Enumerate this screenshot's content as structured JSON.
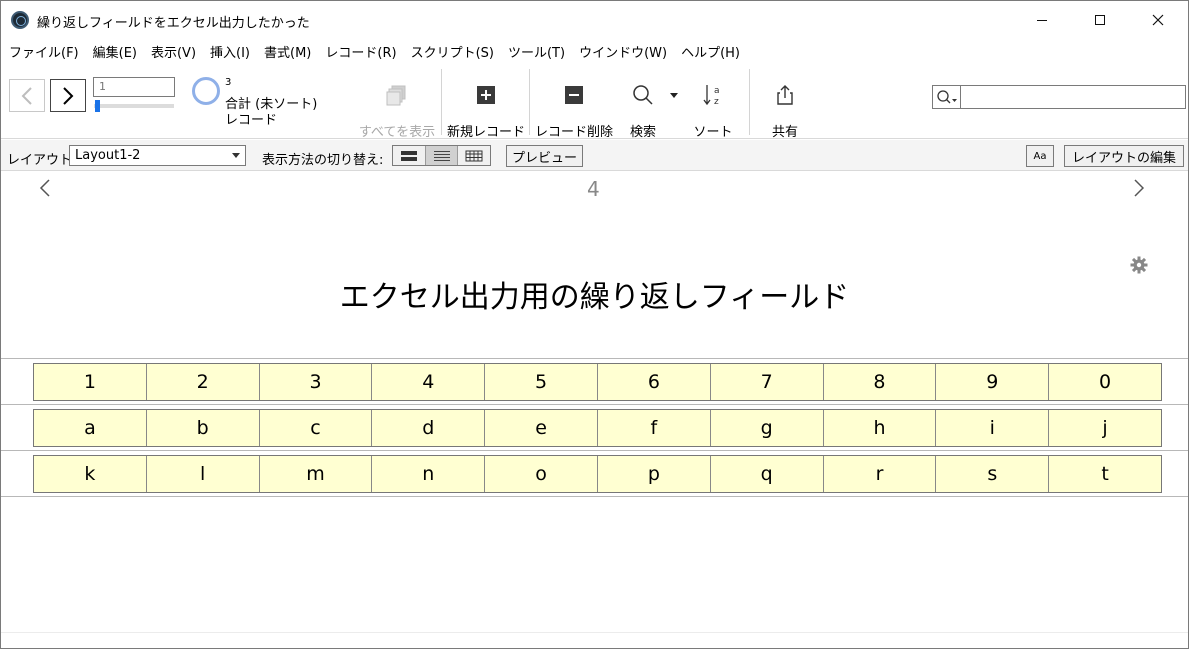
{
  "window": {
    "title": "繰り返しフィールドをエクセル出力したかった"
  },
  "menu": [
    "ファイル(F)",
    "編集(E)",
    "表示(V)",
    "挿入(I)",
    "書式(M)",
    "レコード(R)",
    "スクリプト(S)",
    "ツール(T)",
    "ウインドウ(W)",
    "ヘルプ(H)"
  ],
  "toolbar": {
    "record_input": "1",
    "record_position": 0.0,
    "count": "3",
    "count_label": "合計 (未ソート)",
    "count_unit": "レコード",
    "show_all": "すべてを表示",
    "new_record": "新規レコード",
    "delete_record": "レコード削除",
    "find": "検索",
    "sort": "ソート",
    "share": "共有",
    "search_value": ""
  },
  "layoutbar": {
    "layout_label": "レイアウト:",
    "layout_value": "Layout1-2",
    "view_label": "表示方法の切り替え:",
    "preview": "プレビュー",
    "aa": "Aa",
    "edit_layout": "レイアウトの編集"
  },
  "content": {
    "page_number": "4",
    "title": "エクセル出力用の繰り返しフィールド",
    "rows": [
      [
        "1",
        "2",
        "3",
        "4",
        "5",
        "6",
        "7",
        "8",
        "9",
        "0"
      ],
      [
        "a",
        "b",
        "c",
        "d",
        "e",
        "f",
        "g",
        "h",
        "i",
        "j"
      ],
      [
        "k",
        "l",
        "m",
        "n",
        "o",
        "p",
        "q",
        "r",
        "s",
        "t"
      ]
    ]
  },
  "colors": {
    "field_bg": "#ffffd2",
    "accent": "#1a73e8"
  },
  "icons": [
    "app-icon",
    "minimize-icon",
    "maximize-icon",
    "close-icon",
    "chevron-left-icon",
    "chevron-right-icon",
    "show-all-icon",
    "plus-icon",
    "minus-icon",
    "search-icon",
    "sort-icon",
    "share-icon",
    "gear-icon",
    "list-view-icon",
    "table-view-icon",
    "form-view-icon"
  ]
}
